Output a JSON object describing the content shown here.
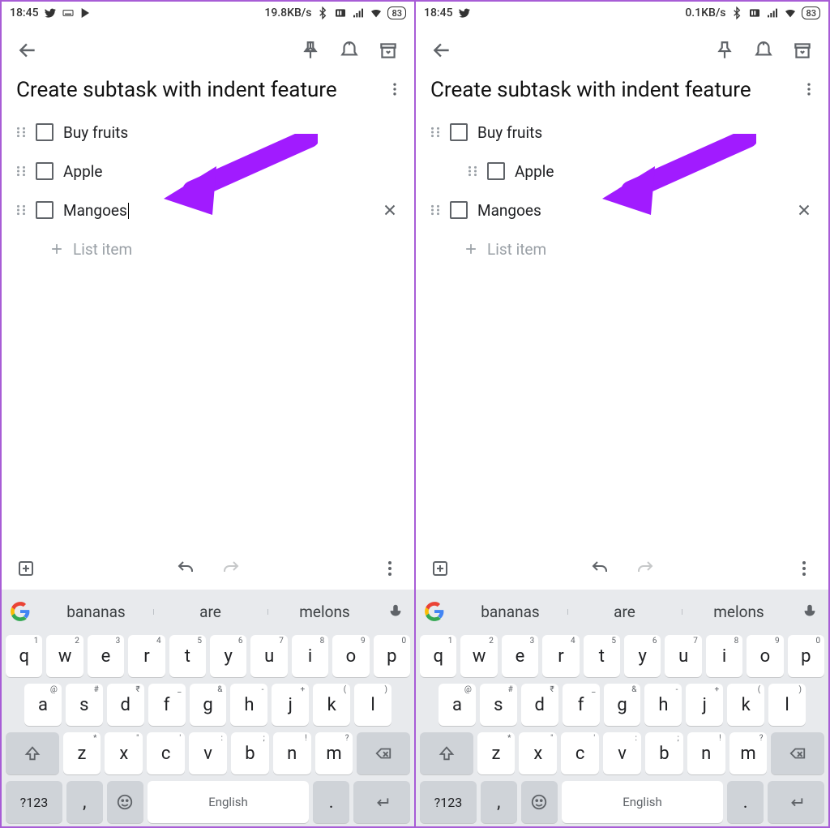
{
  "screens": [
    {
      "status": {
        "time": "18:45",
        "net_speed": "19.8KB/s",
        "battery": "83"
      },
      "note_title": "Create subtask with indent feature",
      "items": [
        {
          "text": "Buy fruits",
          "indent": false,
          "active": false
        },
        {
          "text": "Apple",
          "indent": false,
          "active": false
        },
        {
          "text": "Mangoes",
          "indent": false,
          "active": true,
          "caret": true
        }
      ],
      "list_placeholder": "List item",
      "arrow_target": 1,
      "suggestions": [
        "bananas",
        "are",
        "melons"
      ]
    },
    {
      "status": {
        "time": "18:45",
        "net_speed": "0.1KB/s",
        "battery": "83"
      },
      "note_title": "Create subtask with indent feature",
      "items": [
        {
          "text": "Buy fruits",
          "indent": false,
          "active": false
        },
        {
          "text": "Apple",
          "indent": true,
          "active": false
        },
        {
          "text": "Mangoes",
          "indent": false,
          "active": true,
          "caret": false
        }
      ],
      "list_placeholder": "List item",
      "arrow_target": 1,
      "suggestions": [
        "bananas",
        "are",
        "melons"
      ]
    }
  ],
  "keyboard": {
    "row1": [
      {
        "k": "q",
        "s": "1"
      },
      {
        "k": "w",
        "s": "2"
      },
      {
        "k": "e",
        "s": "3"
      },
      {
        "k": "r",
        "s": "4"
      },
      {
        "k": "t",
        "s": "5"
      },
      {
        "k": "y",
        "s": "6"
      },
      {
        "k": "u",
        "s": "7"
      },
      {
        "k": "i",
        "s": "8"
      },
      {
        "k": "o",
        "s": "9"
      },
      {
        "k": "p",
        "s": "0"
      }
    ],
    "row2": [
      {
        "k": "a",
        "s": "@"
      },
      {
        "k": "s",
        "s": "#"
      },
      {
        "k": "d",
        "s": "₹"
      },
      {
        "k": "f",
        "s": "_"
      },
      {
        "k": "g",
        "s": "&"
      },
      {
        "k": "h",
        "s": "-"
      },
      {
        "k": "j",
        "s": "+"
      },
      {
        "k": "k",
        "s": "("
      },
      {
        "k": "l",
        "s": ")"
      }
    ],
    "row3": [
      {
        "k": "z",
        "s": "*"
      },
      {
        "k": "x",
        "s": "\""
      },
      {
        "k": "c",
        "s": "'"
      },
      {
        "k": "v",
        "s": ":"
      },
      {
        "k": "b",
        "s": ";"
      },
      {
        "k": "n",
        "s": "!"
      },
      {
        "k": "m",
        "s": "?"
      }
    ],
    "symbols_label": "?123",
    "comma": ",",
    "period": ".",
    "space_label": "English"
  }
}
